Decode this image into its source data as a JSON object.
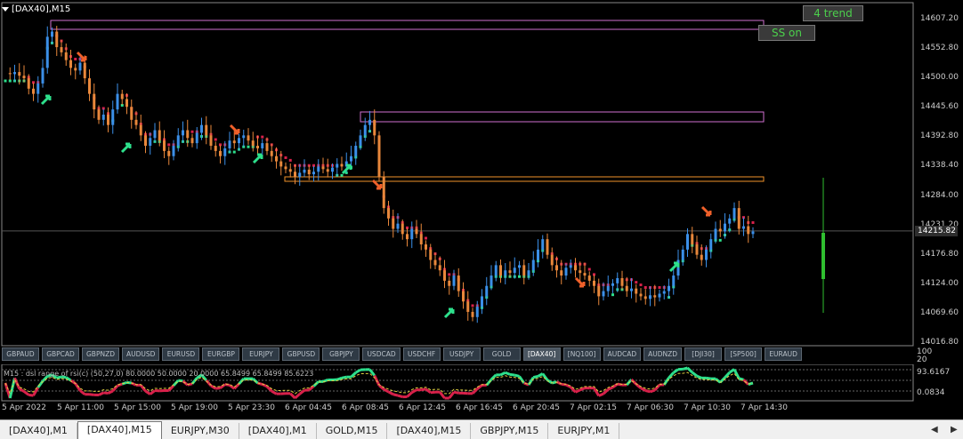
{
  "window": {
    "title": "[DAX40],M15"
  },
  "buttons": {
    "trend": "4 trend",
    "ss": "SS on"
  },
  "price_axis": {
    "labels": [
      "14607.20",
      "14552.80",
      "14500.00",
      "14445.60",
      "14392.80",
      "14338.40",
      "14284.00",
      "14231.20",
      "14176.80",
      "14124.00",
      "14069.60",
      "14016.80"
    ],
    "current": "14215.82"
  },
  "symbols": [
    "GBPAUD",
    "GBPCAD",
    "GBPNZD",
    "AUDUSD",
    "EURUSD",
    "EURGBP",
    "EURJPY",
    "GBPUSD",
    "GBPJPY",
    "USDCAD",
    "USDCHF",
    "USDJPY",
    "GOLD",
    "[DAX40]",
    "[NQ100]",
    "AUDCAD",
    "AUDNZD",
    "[DJI30]",
    "[SP500]",
    "EURAUD"
  ],
  "active_symbol": "[DAX40]",
  "sub_window": {
    "label": "M15 : dsl range of rsi(c) (50,27,0) 80.0000 50.0000 20.0000 65.8499 65.8499 85.6223",
    "scale_top": "100",
    "scale_mid": "20",
    "value_high": "93.6167",
    "value_low": "0.0834"
  },
  "time_axis": [
    "5 Apr 2022",
    "5 Apr 11:00",
    "5 Apr 15:00",
    "5 Apr 19:00",
    "5 Apr 23:30",
    "6 Apr 04:45",
    "6 Apr 08:45",
    "6 Apr 12:45",
    "6 Apr 16:45",
    "6 Apr 20:45",
    "7 Apr 02:15",
    "7 Apr 06:30",
    "7 Apr 10:30",
    "7 Apr 14:30"
  ],
  "tabs": [
    "[DAX40],M1",
    "[DAX40],M15",
    "EURJPY,M30",
    "[DAX40],M1",
    "GOLD,M15",
    "[DAX40],M15",
    "GBPJPY,M15",
    "EURJPY,M1"
  ],
  "active_tab": "[DAX40],M15",
  "colors": {
    "bull": "#3b8fe8",
    "bear": "#e8873b",
    "trail_up": "#2de08c",
    "trail_down": "#d8214a",
    "zone_purple": "#d070d0",
    "zone_orange": "#f0922a",
    "arrow_up": "#2de08c",
    "arrow_down": "#f0602a"
  },
  "chart_data": {
    "type": "candlestick",
    "price_range": [
      14000,
      14630
    ],
    "closes": [
      14520,
      14518,
      14522,
      14515,
      14510,
      14490,
      14480,
      14500,
      14530,
      14590,
      14600,
      14570,
      14560,
      14545,
      14530,
      14525,
      14540,
      14510,
      14480,
      14450,
      14430,
      14440,
      14420,
      14450,
      14480,
      14470,
      14455,
      14430,
      14420,
      14400,
      14380,
      14395,
      14410,
      14390,
      14370,
      14360,
      14380,
      14400,
      14410,
      14395,
      14385,
      14405,
      14420,
      14400,
      14380,
      14370,
      14360,
      14375,
      14390,
      14385,
      14395,
      14400,
      14390,
      14380,
      14375,
      14385,
      14370,
      14360,
      14350,
      14340,
      14335,
      14330,
      14320,
      14328,
      14334,
      14325,
      14330,
      14340,
      14335,
      14330,
      14338,
      14345,
      14340,
      14350,
      14360,
      14380,
      14400,
      14420,
      14430,
      14400,
      14320,
      14260,
      14240,
      14220,
      14230,
      14210,
      14200,
      14220,
      14210,
      14190,
      14180,
      14160,
      14150,
      14140,
      14120,
      14110,
      14130,
      14100,
      14080,
      14060,
      14050,
      14070,
      14090,
      14110,
      14130,
      14150,
      14130,
      14140,
      14135,
      14145,
      14150,
      14130,
      14140,
      14160,
      14180,
      14200,
      14170,
      14150,
      14140,
      14130,
      14145,
      14150,
      14140,
      14135,
      14130,
      14120,
      14110,
      14090,
      14100,
      14110,
      14115,
      14125,
      14110,
      14100,
      14105,
      14095,
      14090,
      14085,
      14092,
      14088,
      14095,
      14100,
      14110,
      14130,
      14160,
      14180,
      14210,
      14190,
      14170,
      14160,
      14180,
      14200,
      14220,
      14215,
      14230,
      14240,
      14260,
      14220,
      14225,
      14210,
      14215
    ]
  }
}
